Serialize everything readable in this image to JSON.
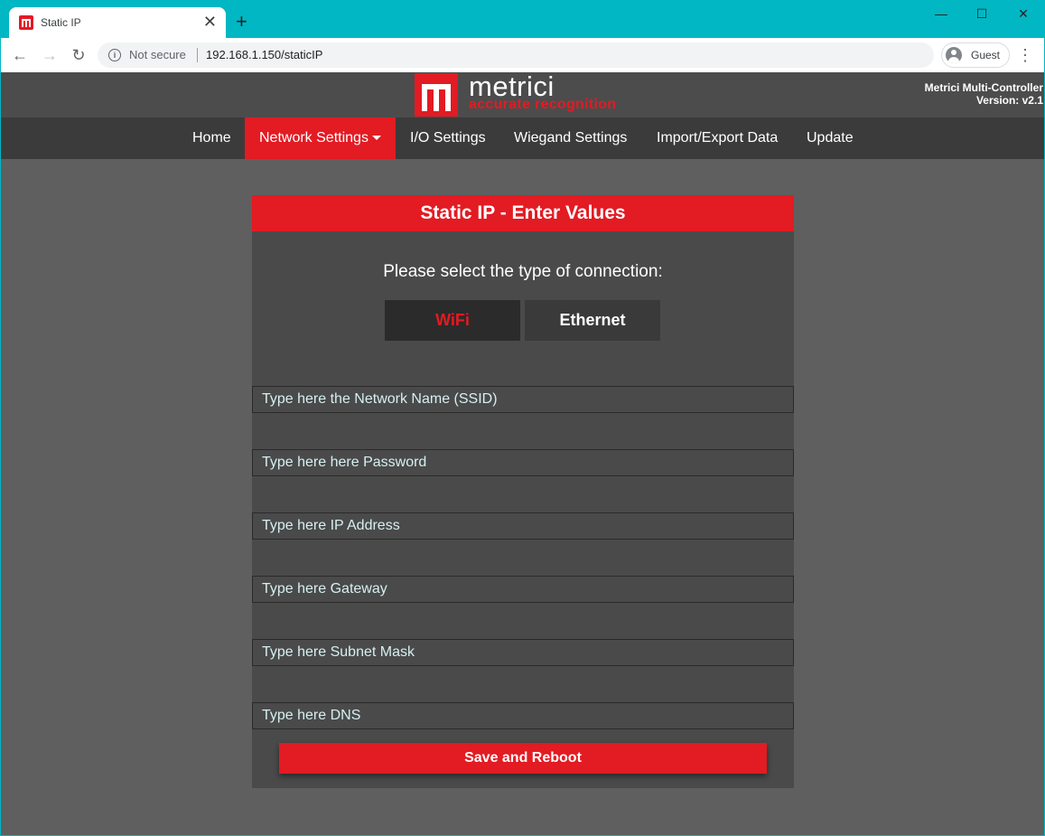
{
  "browser": {
    "tab_title": "Static IP",
    "tab_close_glyph": "✕",
    "new_tab_glyph": "+",
    "window_controls": {
      "minimize": "—",
      "maximize": "☐",
      "close": "✕"
    },
    "nav": {
      "back": "←",
      "forward": "→",
      "reload": "↻"
    },
    "security_label": "Not secure",
    "url": "192.168.1.150/staticIP",
    "profile_label": "Guest",
    "menu_glyph": "⋮"
  },
  "site": {
    "logo_name": "metrici",
    "logo_tagline": "accurate recognition",
    "product_name": "Metrici Multi-Controller",
    "product_version": "Version: v2.1",
    "brand_color": "#e31b23"
  },
  "navbar": {
    "items": [
      {
        "label": "Home",
        "active": false
      },
      {
        "label": "Network Settings",
        "active": true,
        "has_dropdown": true
      },
      {
        "label": "I/O Settings",
        "active": false
      },
      {
        "label": "Wiegand Settings",
        "active": false
      },
      {
        "label": "Import/Export Data",
        "active": false
      },
      {
        "label": "Update",
        "active": false
      }
    ]
  },
  "form": {
    "title": "Static IP - Enter Values",
    "prompt": "Please select the type of connection:",
    "connection_types": [
      {
        "label": "WiFi",
        "selected": true
      },
      {
        "label": "Ethernet",
        "selected": false
      }
    ],
    "fields": [
      {
        "placeholder": "Type here the Network Name (SSID)",
        "value": ""
      },
      {
        "placeholder": "Type here here Password",
        "value": ""
      },
      {
        "placeholder": "Type here IP Address",
        "value": ""
      },
      {
        "placeholder": "Type here Gateway",
        "value": ""
      },
      {
        "placeholder": "Type here Subnet Mask",
        "value": ""
      },
      {
        "placeholder": "Type here DNS",
        "value": ""
      }
    ],
    "submit_label": "Save and Reboot"
  }
}
